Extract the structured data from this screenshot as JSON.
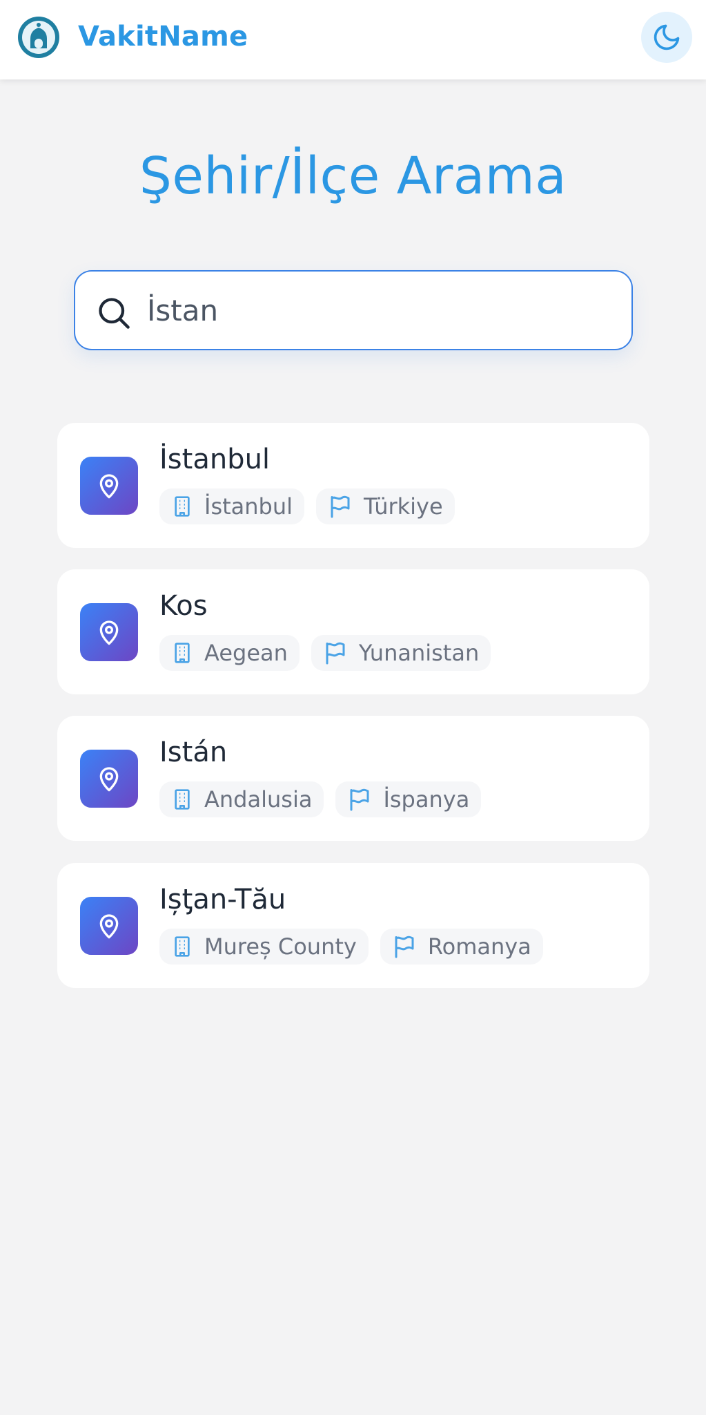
{
  "header": {
    "brand": "VakitName",
    "logo_icon": "mosque-logo-icon",
    "theme_toggle_icon": "moon-icon"
  },
  "page": {
    "title": "Şehir/İlçe Arama"
  },
  "search": {
    "value": "İstan",
    "icon": "search-icon"
  },
  "colors": {
    "accent": "#2b97e3",
    "input_border": "#3b82e6",
    "pin_gradient_start": "#3b82f6",
    "pin_gradient_end": "#6d46c4",
    "chip_icon": "#4aa3e6"
  },
  "results": [
    {
      "name": "İstanbul",
      "region": "İstanbul",
      "country": "Türkiye"
    },
    {
      "name": "Kos",
      "region": "Aegean",
      "country": "Yunanistan"
    },
    {
      "name": "Istán",
      "region": "Andalusia",
      "country": "İspanya"
    },
    {
      "name": "Ișƫan-Tău",
      "region": "Mureș County",
      "country": "Romanya"
    }
  ]
}
